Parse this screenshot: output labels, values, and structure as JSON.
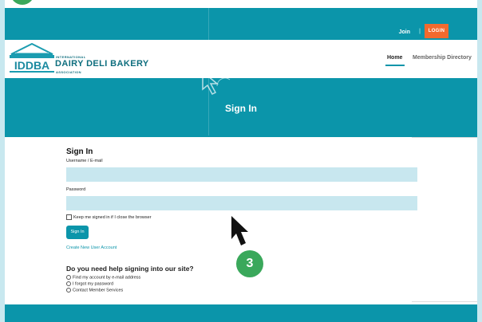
{
  "top_bar": {
    "join": "Join",
    "separator": "|",
    "login": "LOGIN"
  },
  "header": {
    "org_line1": "INTERNATIONAL",
    "org_name": "DAIRY DELI BAKERY",
    "org_line3": "ASSOCIATION",
    "logo_text": "IDDBA",
    "nav": [
      "Home",
      "Membership Directory"
    ]
  },
  "banner": {
    "title": "Sign In"
  },
  "form": {
    "heading": "Sign In",
    "username_label": "Username / E-mail",
    "username_value": "",
    "password_label": "Password",
    "password_value": "",
    "remember_label": "Keep me signed in if I close the browser",
    "signin_button": "Sign In",
    "create_link": "Create New User Account"
  },
  "help": {
    "heading": "Do you need help signing into our site?",
    "options": [
      "Find my account by e-mail address",
      "I forgot my password",
      "Contact Member Services"
    ]
  },
  "overlay": {
    "step_badge": "3"
  },
  "colors": {
    "teal": "#0b95aa",
    "orange": "#f26a2e",
    "green": "#3aa85b",
    "field": "#c8e7ef"
  }
}
